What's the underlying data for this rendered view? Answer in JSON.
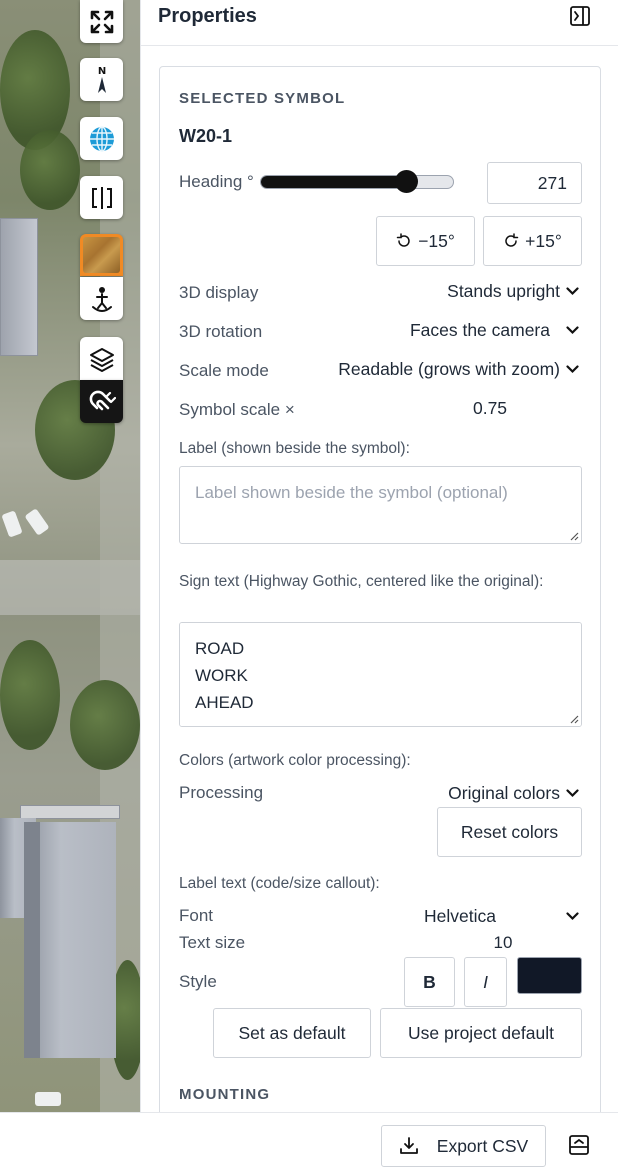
{
  "map_tools": [
    {
      "name": "fullscreen-icon"
    },
    {
      "name": "compass-north-icon",
      "label": "N"
    },
    {
      "name": "globe-icon"
    },
    {
      "name": "split-view-icon"
    },
    {
      "name": "basemap-imagery-swatch"
    },
    {
      "name": "street-view-person-icon"
    },
    {
      "name": "layers-icon"
    },
    {
      "name": "snap-magnet-icon"
    }
  ],
  "panel": {
    "title": "Properties",
    "selected_symbol": {
      "section_title": "SELECTED SYMBOL",
      "code": "W20-1",
      "heading_label": "Heading °",
      "heading_value": "271",
      "heading_fraction": 0.753,
      "rotate_minus_label": "−15°",
      "rotate_plus_label": "+15°",
      "display_3d_label": "3D display",
      "display_3d_value": "Stands upright",
      "rotation_3d_label": "3D rotation",
      "rotation_3d_value": "Faces the camera",
      "scale_mode_label": "Scale mode",
      "scale_mode_value": "Readable (grows with zoom)",
      "symbol_scale_label": "Symbol scale ×",
      "symbol_scale_value": "0.75",
      "label_field_caption": "Label (shown beside the symbol):",
      "label_field_placeholder": "Label shown beside the symbol (optional)",
      "label_field_value": "",
      "sign_text_caption": "Sign text (Highway Gothic, centered like the original):",
      "sign_text_value": "ROAD\nWORK\nAHEAD",
      "colors_caption": "Colors (artwork color processing):",
      "processing_label": "Processing",
      "processing_value": "Original colors",
      "reset_colors_label": "Reset colors",
      "label_text_caption": "Label text (code/size callout):",
      "font_label": "Font",
      "font_value": "Helvetica",
      "text_size_label": "Text size",
      "text_size_value": "10",
      "style_label": "Style",
      "bold_label": "B",
      "italic_label": "I",
      "text_color": "#111827",
      "set_default_label": "Set as default",
      "use_project_default_label": "Use project default"
    },
    "mounting": {
      "section_title": "MOUNTING"
    }
  },
  "footer": {
    "export_label": "Export CSV"
  },
  "colors": {
    "accent_orange": "#f08a24",
    "dark_tool": "#151515"
  }
}
